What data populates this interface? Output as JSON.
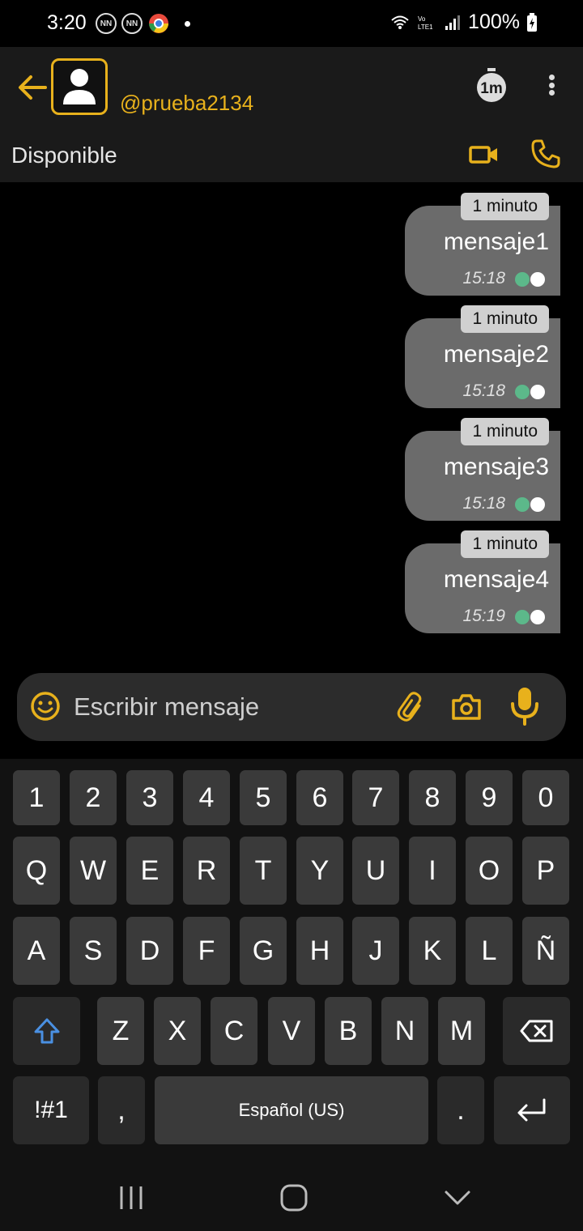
{
  "status_bar": {
    "time": "3:20",
    "notif_icons": [
      "NN",
      "NN"
    ],
    "battery": "100%"
  },
  "header": {
    "username": "@prueba2134",
    "status": "Disponible",
    "timer_label": "1m"
  },
  "messages": [
    {
      "badge": "1 minuto",
      "text": "mensaje1",
      "time": "15:18"
    },
    {
      "badge": "1 minuto",
      "text": "mensaje2",
      "time": "15:18"
    },
    {
      "badge": "1 minuto",
      "text": "mensaje3",
      "time": "15:18"
    },
    {
      "badge": "1 minuto",
      "text": "mensaje4",
      "time": "15:19"
    }
  ],
  "compose": {
    "placeholder": "Escribir mensaje"
  },
  "keyboard": {
    "row1": [
      "1",
      "2",
      "3",
      "4",
      "5",
      "6",
      "7",
      "8",
      "9",
      "0"
    ],
    "row2": [
      "Q",
      "W",
      "E",
      "R",
      "T",
      "Y",
      "U",
      "I",
      "O",
      "P"
    ],
    "row3": [
      "A",
      "S",
      "D",
      "F",
      "G",
      "H",
      "J",
      "K",
      "L",
      "Ñ"
    ],
    "row4": [
      "Z",
      "X",
      "C",
      "V",
      "B",
      "N",
      "M"
    ],
    "symbols": "!#1",
    "comma": ",",
    "space": "Español (US)",
    "period": "."
  },
  "colors": {
    "accent": "#e8b11c",
    "bubble": "#6b6b6b",
    "tick_green": "#5cb88a",
    "shift_blue": "#4a90e2"
  }
}
